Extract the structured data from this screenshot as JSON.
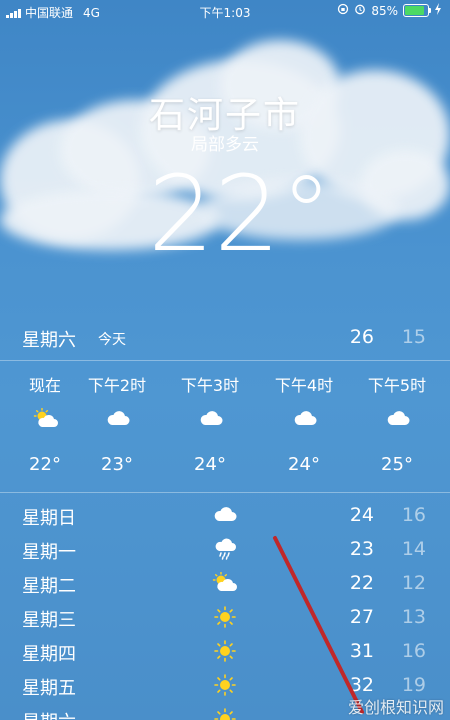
{
  "status_bar": {
    "carrier": "中国联通",
    "network": "4G",
    "time": "下午1:03",
    "battery_percent": "85%",
    "battery_level": 0.85,
    "battery_color": "#4cd964"
  },
  "location": {
    "city": "石河子市",
    "condition": "局部多云",
    "temperature": "22°"
  },
  "today": {
    "day": "星期六",
    "label": "今天",
    "high": "26",
    "low": "15"
  },
  "hourly": [
    {
      "time": "现在",
      "icon": "partly-cloudy-icon",
      "temp": "22°"
    },
    {
      "time": "下午2时",
      "icon": "cloud-icon",
      "temp": "23°"
    },
    {
      "time": "下午3时",
      "icon": "cloud-icon",
      "temp": "24°"
    },
    {
      "time": "下午4时",
      "icon": "cloud-icon",
      "temp": "24°"
    },
    {
      "time": "下午5时",
      "icon": "cloud-icon",
      "temp": "25°"
    }
  ],
  "daily": [
    {
      "day": "星期日",
      "icon": "cloud-icon",
      "high": "24",
      "low": "16"
    },
    {
      "day": "星期一",
      "icon": "rain-icon",
      "high": "23",
      "low": "14"
    },
    {
      "day": "星期二",
      "icon": "partly-cloudy-icon",
      "high": "22",
      "low": "12"
    },
    {
      "day": "星期三",
      "icon": "sun-icon",
      "high": "27",
      "low": "13"
    },
    {
      "day": "星期四",
      "icon": "sun-icon",
      "high": "31",
      "low": "16"
    },
    {
      "day": "星期五",
      "icon": "sun-icon",
      "high": "32",
      "low": "19"
    },
    {
      "day": "星期六",
      "icon": "sun-icon",
      "high": "",
      "low": ""
    }
  ],
  "watermark": "爱创根知识网",
  "colors": {
    "sky": "#4b93d0",
    "annotation_arrow": "#c0282a"
  }
}
